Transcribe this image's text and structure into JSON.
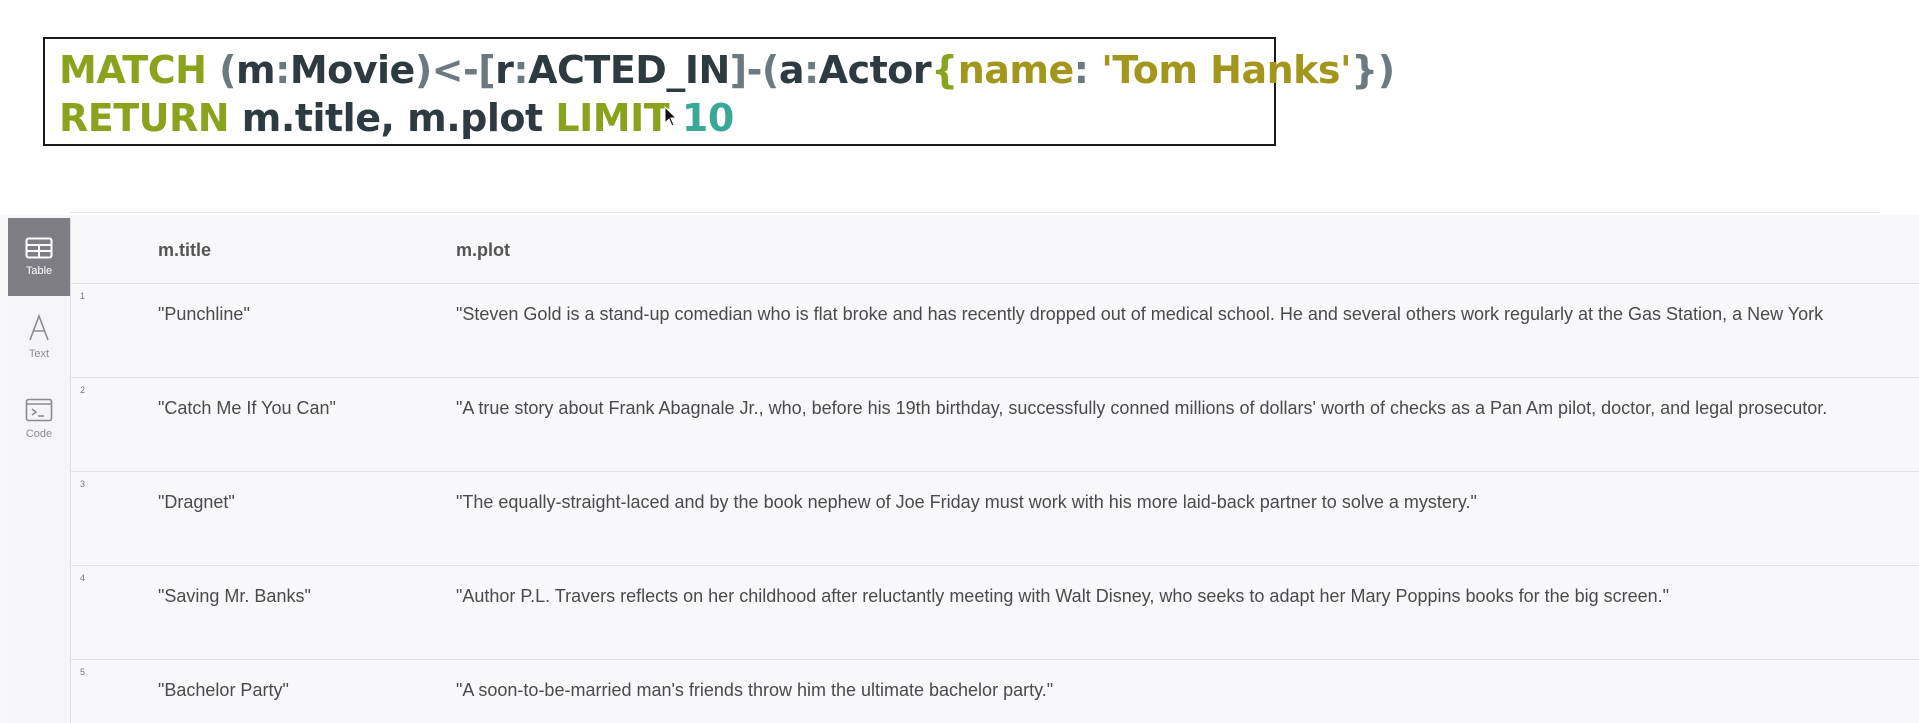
{
  "query": {
    "line1": [
      {
        "t": "MATCH ",
        "c": "kw"
      },
      {
        "t": "(",
        "c": "punc"
      },
      {
        "t": "m",
        "c": "ident"
      },
      {
        "t": ":",
        "c": "punc"
      },
      {
        "t": "Movie",
        "c": "ident"
      },
      {
        "t": ")<-[",
        "c": "punc"
      },
      {
        "t": "r",
        "c": "ident"
      },
      {
        "t": ":",
        "c": "punc"
      },
      {
        "t": "ACTED_IN",
        "c": "ident"
      },
      {
        "t": "]-(",
        "c": "punc"
      },
      {
        "t": "a",
        "c": "ident"
      },
      {
        "t": ":",
        "c": "punc"
      },
      {
        "t": "Actor",
        "c": "ident"
      },
      {
        "t": "{",
        "c": "kw"
      },
      {
        "t": "name",
        "c": "str"
      },
      {
        "t": ": ",
        "c": "punc"
      },
      {
        "t": "'Tom Hanks'",
        "c": "str"
      },
      {
        "t": "})",
        "c": "punc"
      }
    ],
    "line2": [
      {
        "t": "RETURN ",
        "c": "kw"
      },
      {
        "t": "m.title, m.plot ",
        "c": "ident"
      },
      {
        "t": "LIMIT ",
        "c": "kw"
      },
      {
        "t": "10",
        "c": "num"
      }
    ]
  },
  "sidebar": {
    "table_label": "Table",
    "text_label": "Text",
    "code_label": "Code"
  },
  "table": {
    "columns": [
      "m.title",
      "m.plot"
    ],
    "rows": [
      {
        "n": "1",
        "title": "\"Punchline\"",
        "plot": "\"Steven Gold is a stand-up comedian who is flat broke and has recently dropped out of medical school. He and several others work regularly at the Gas Station, a New York"
      },
      {
        "n": "2",
        "title": "\"Catch Me If You Can\"",
        "plot": "\"A true story about Frank Abagnale Jr., who, before his 19th birthday, successfully conned millions of dollars' worth of checks as a Pan Am pilot, doctor, and legal prosecutor."
      },
      {
        "n": "3",
        "title": "\"Dragnet\"",
        "plot": "\"The equally-straight-laced and by the book nephew of Joe Friday must work with his more laid-back partner to solve a mystery.\""
      },
      {
        "n": "4",
        "title": "\"Saving Mr. Banks\"",
        "plot": "\"Author P.L. Travers reflects on her childhood after reluctantly meeting with Walt Disney, who seeks to adapt her Mary Poppins books for the big screen.\""
      },
      {
        "n": "5",
        "title": "\"Bachelor Party\"",
        "plot": "\"A soon-to-be-married man's friends throw him the ultimate bachelor party.\""
      }
    ]
  }
}
